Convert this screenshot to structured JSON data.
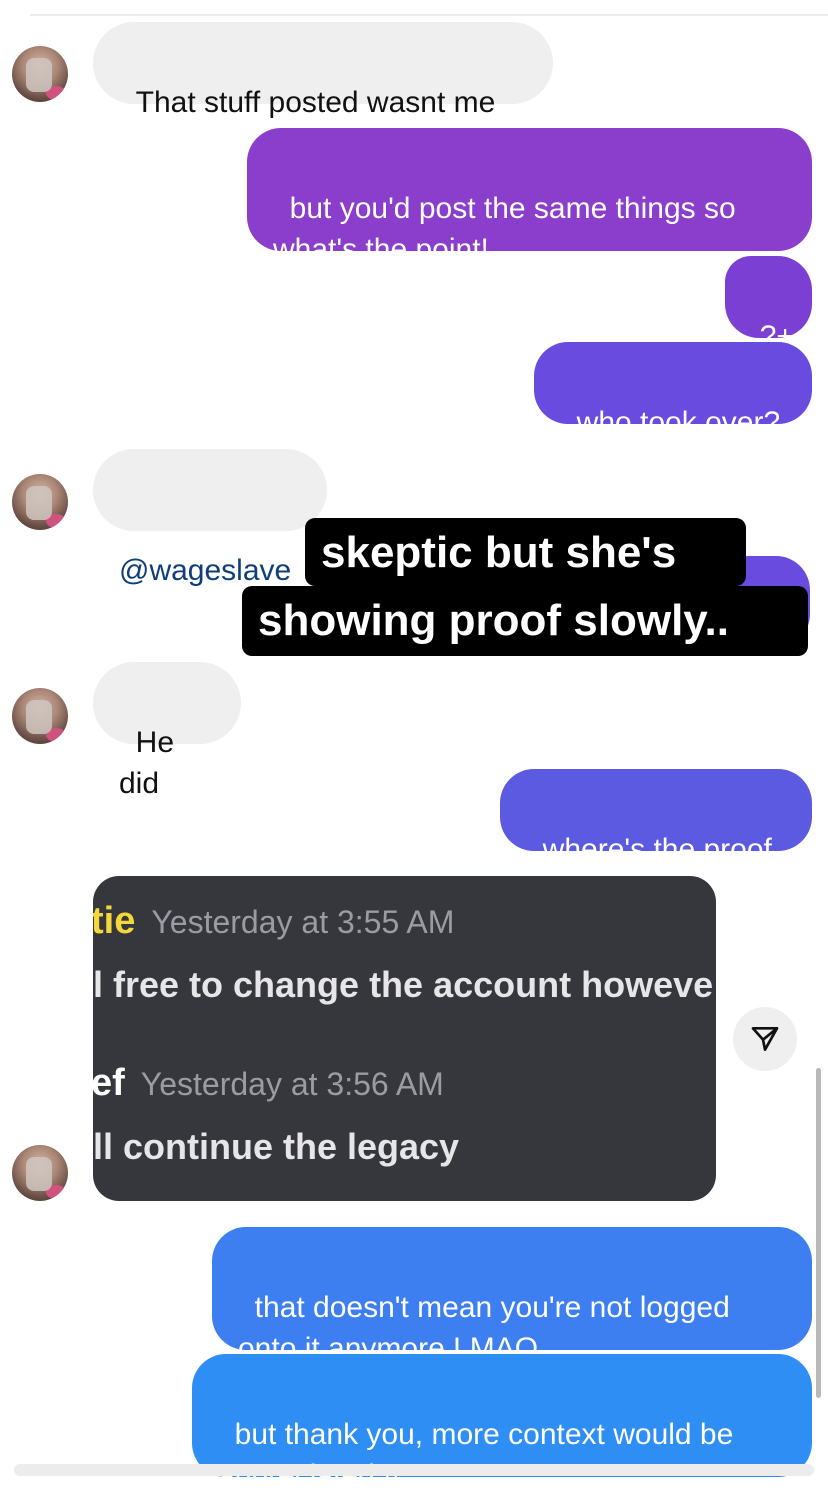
{
  "messages": [
    {
      "id": "m1",
      "direction": "incoming",
      "text": "That stuff posted wasnt me"
    },
    {
      "id": "m2",
      "direction": "outgoing",
      "text": "but you'd post the same things so\nwhat's the point!"
    },
    {
      "id": "m3",
      "direction": "outgoing",
      "text": "?+"
    },
    {
      "id": "m4",
      "direction": "outgoing",
      "text": "who took over?"
    },
    {
      "id": "m5",
      "direction": "incoming",
      "text": "@wageslave"
    },
    {
      "id": "m6",
      "direction": "incoming",
      "text": "He did"
    },
    {
      "id": "m7",
      "direction": "outgoing",
      "text": "where's the proof"
    },
    {
      "id": "m8",
      "direction": "outgoing",
      "text": "that doesn't mean you're not logged\nonto it anymore LMAO"
    },
    {
      "id": "m9",
      "direction": "outgoing",
      "text": "but thank you, more context would be\nappreciated !!"
    }
  ],
  "overlay_caption": {
    "line1": "skeptic but she's",
    "line2": "showing proof slowly.."
  },
  "attached_screenshot": {
    "row1": {
      "name": "tie",
      "time": "Yesterday at 3:55 AM",
      "message": "l free to change the account howeve"
    },
    "row2": {
      "name": "ef",
      "time": "Yesterday at 3:56 AM",
      "message": "ll continue the legacy"
    }
  },
  "icons": {
    "share": "paper-plane-icon",
    "avatar": "user-avatar"
  },
  "colors": {
    "incoming_bubble": "#efefef",
    "outgoing_purple": "#8b3ecb",
    "outgoing_indigo": "#6a4be0",
    "outgoing_blue": "#2f8ef3",
    "mention": "#0f3d7a"
  }
}
